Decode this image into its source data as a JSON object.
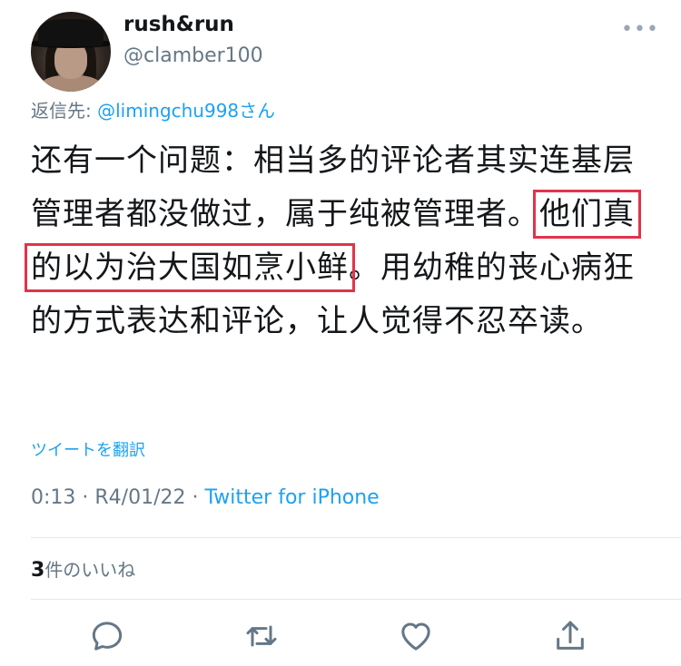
{
  "user": {
    "display_name": "rush&run",
    "handle": "@clamber100"
  },
  "reply": {
    "prefix": "返信先: ",
    "mention": "@limingchu998さん"
  },
  "tweet": {
    "before": "还有一个问题：相当多的评论者其实连基层管理者都没做过，属于纯被管理者。",
    "highlight": "他们真的以为治大国如烹小鲜",
    "after": "。用幼稚的丧心病狂的方式表达和评论，让人觉得不忍卒读。"
  },
  "translate_label": "ツイートを翻訳",
  "meta": {
    "time": "0:13",
    "date": "R4/01/22",
    "separator": " · ",
    "source": "Twitter for iPhone"
  },
  "likes": {
    "count": "3",
    "label": "件のいいね"
  },
  "icons": {
    "avatar": "profile-photo",
    "more": "more-dots-icon",
    "reply": "reply-bubble-icon",
    "retweet": "retweet-icon",
    "like": "heart-icon",
    "share": "share-icon"
  },
  "colors": {
    "link": "#1da1f2",
    "muted": "#657786",
    "highlight_border": "#e0344a",
    "icon": "#657786"
  }
}
